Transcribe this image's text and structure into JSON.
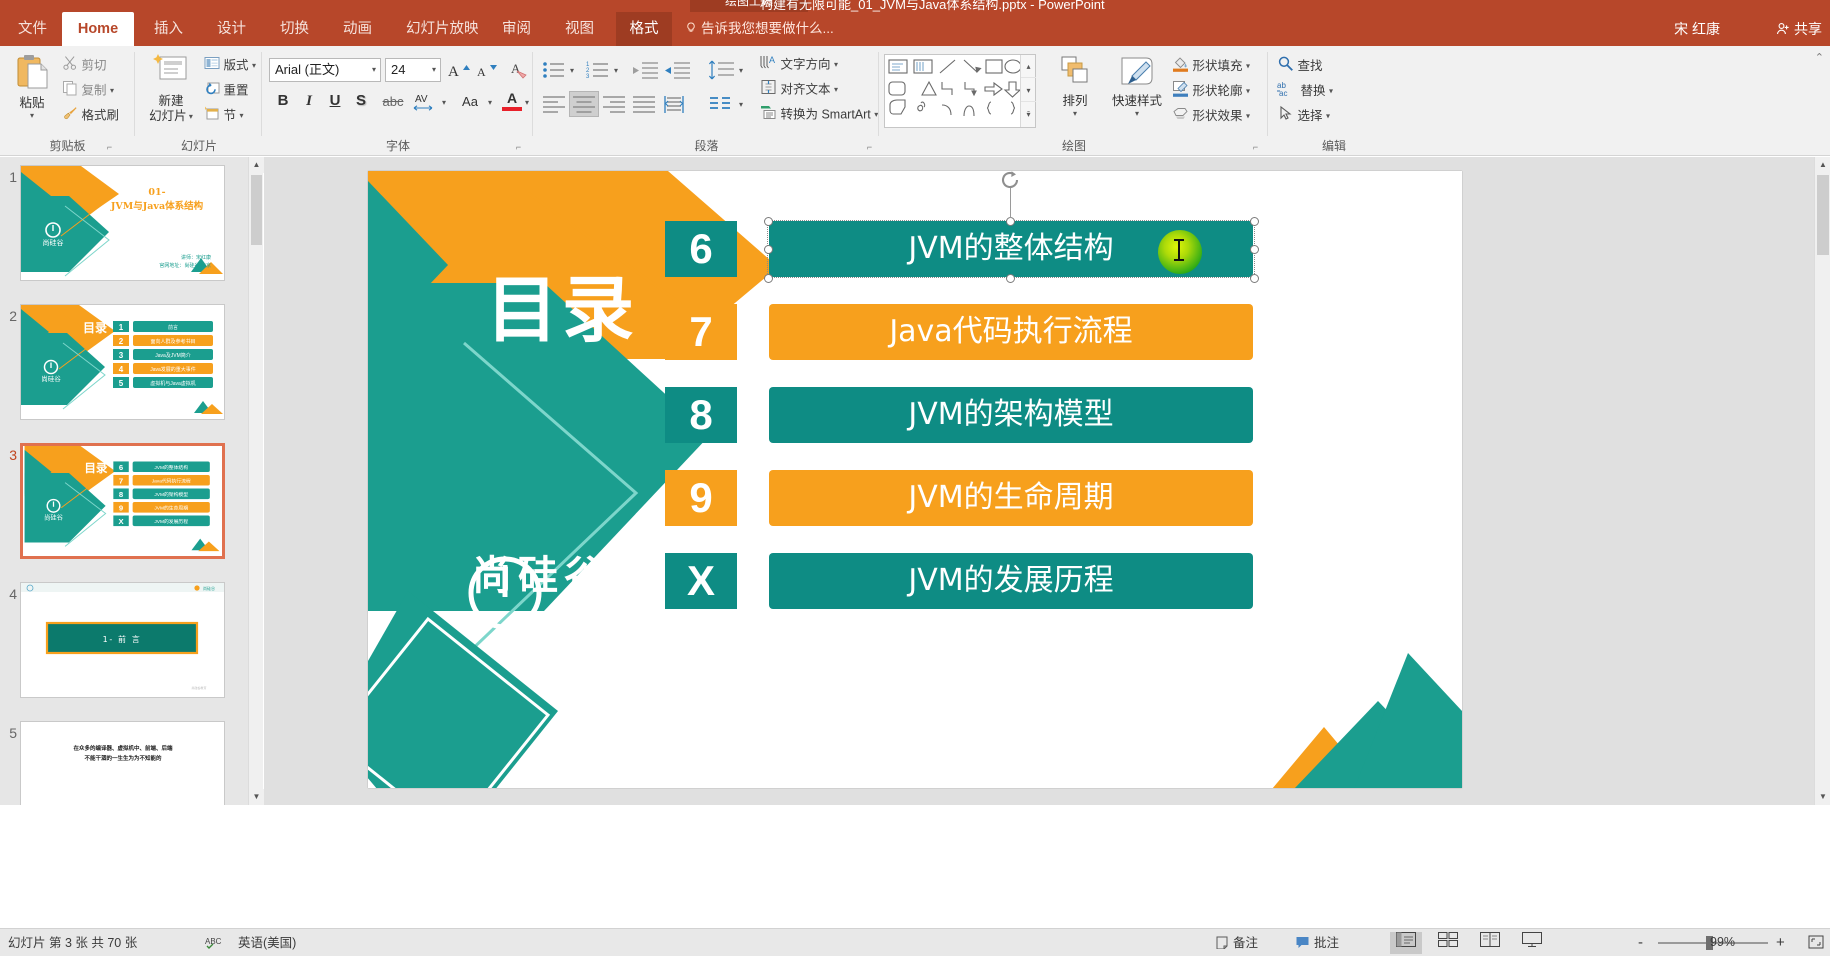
{
  "window": {
    "title": "构建有无限可能_01_JVM与Java体系结构.pptx - PowerPoint",
    "context_tab_group": "绘图工具",
    "user_name": "宋 红康",
    "share_label": "共享"
  },
  "tabs": [
    {
      "label": "文件",
      "active": false,
      "kind": "file"
    },
    {
      "label": "Home",
      "active": true,
      "kind": "normal"
    },
    {
      "label": "插入",
      "active": false,
      "kind": "normal"
    },
    {
      "label": "设计",
      "active": false,
      "kind": "normal"
    },
    {
      "label": "切换",
      "active": false,
      "kind": "normal"
    },
    {
      "label": "动画",
      "active": false,
      "kind": "normal"
    },
    {
      "label": "幻灯片放映",
      "active": false,
      "kind": "normal"
    },
    {
      "label": "审阅",
      "active": false,
      "kind": "normal"
    },
    {
      "label": "视图",
      "active": false,
      "kind": "normal"
    },
    {
      "label": "格式",
      "active": false,
      "kind": "context"
    }
  ],
  "tell_me": "告诉我您想要做什么...",
  "ribbon": {
    "groups": [
      {
        "name": "clipboard",
        "label": "剪贴板",
        "has_launcher": true
      },
      {
        "name": "slides",
        "label": "幻灯片",
        "has_launcher": false
      },
      {
        "name": "font",
        "label": "字体",
        "has_launcher": true
      },
      {
        "name": "paragraph",
        "label": "段落",
        "has_launcher": true
      },
      {
        "name": "drawing",
        "label": "绘图",
        "has_launcher": true
      },
      {
        "name": "editing",
        "label": "编辑",
        "has_launcher": false
      }
    ],
    "clipboard": {
      "paste": "粘贴",
      "cut": "剪切",
      "copy": "复制",
      "format_painter": "格式刷"
    },
    "slides": {
      "new_slide": "新建\n幻灯片",
      "new_slide_l1": "新建",
      "new_slide_l2": "幻灯片",
      "layout": "版式",
      "reset": "重置",
      "section": "节"
    },
    "font": {
      "font_name": "Arial (正文)",
      "font_size": "24",
      "grow": "A",
      "shrink": "A",
      "clear_format": "清除所有格式",
      "bold": "B",
      "italic": "I",
      "underline": "U",
      "shadow": "S",
      "strikethrough": "abc",
      "char_spacing": "AV",
      "change_case": "Aa",
      "font_color": "A"
    },
    "paragraph": {
      "bullets": "项目符号",
      "numbering": "编号",
      "dec_indent": "减少缩进量",
      "inc_indent": "增加缩进量",
      "line_spacing": "行距",
      "columns": "分栏",
      "align_left": "左对齐",
      "align_center": "居中",
      "align_right": "右对齐",
      "justify": "两端对齐",
      "distribute": "分散对齐",
      "text_direction": "文字方向",
      "align_text": "对齐文本",
      "convert_smartart": "转换为 SmartArt"
    },
    "drawing": {
      "arrange": "排列",
      "quick_styles": "快速样式",
      "shape_fill": "形状填充",
      "shape_outline": "形状轮廓",
      "shape_effects": "形状效果"
    },
    "editing": {
      "find": "查找",
      "replace": "替换",
      "select": "选择"
    }
  },
  "thumbnails": [
    {
      "number": "1",
      "selected": false,
      "type": "title",
      "title_l1": "01-",
      "title_l2": "JVM与Java体系结构",
      "footer_l1": "讲师：宋红康",
      "footer_l2": "官网地址：尚硅谷-北京"
    },
    {
      "number": "2",
      "selected": false,
      "type": "toc",
      "heading": "目录",
      "items": [
        {
          "n": "1",
          "t": "前言",
          "c": "teal"
        },
        {
          "n": "2",
          "t": "面向人群及参考书目",
          "c": "orange"
        },
        {
          "n": "3",
          "t": "Java及JVM简介",
          "c": "teal"
        },
        {
          "n": "4",
          "t": "Java发展的重大事件",
          "c": "orange"
        },
        {
          "n": "5",
          "t": "虚拟机与Java虚拟机",
          "c": "teal"
        }
      ]
    },
    {
      "number": "3",
      "selected": true,
      "type": "toc",
      "heading": "目录",
      "items": [
        {
          "n": "6",
          "t": "JVM的整体结构",
          "c": "teal"
        },
        {
          "n": "7",
          "t": "Java代码执行流程",
          "c": "orange"
        },
        {
          "n": "8",
          "t": "JVM的架构模型",
          "c": "teal"
        },
        {
          "n": "9",
          "t": "JVM的生命周期",
          "c": "orange"
        },
        {
          "n": "X",
          "t": "JVM的发展历程",
          "c": "teal"
        }
      ]
    },
    {
      "number": "4",
      "selected": false,
      "type": "section",
      "banner": "1- 前 言"
    },
    {
      "number": "5",
      "selected": false,
      "type": "text",
      "line1": "在众多的编译器、虚拟机中、前端、后端",
      "line2": "不能干涸的一生生为为不知能的"
    }
  ],
  "slide": {
    "heading": "目录",
    "logo": "尚硅谷",
    "items": [
      {
        "number": "6",
        "text": "JVM的整体结构",
        "color": "teal",
        "selected": true
      },
      {
        "number": "7",
        "text": "Java代码执行流程",
        "color": "orange",
        "selected": false
      },
      {
        "number": "8",
        "text": "JVM的架构模型",
        "color": "teal",
        "selected": false
      },
      {
        "number": "9",
        "text": "JVM的生命周期",
        "color": "orange",
        "selected": false
      },
      {
        "number": "X",
        "text": "JVM的发展历程",
        "color": "teal",
        "selected": false
      }
    ]
  },
  "status": {
    "slide_counter": "幻灯片 第 3 张  共 70 张",
    "language": "英语(美国)",
    "notes": "备注",
    "comments": "批注",
    "zoom_level": "99%",
    "zoom_out": "-",
    "zoom_in": "+"
  },
  "colors": {
    "ribbon_red": "#b7472a",
    "context_red": "#9e3c22",
    "teal": "#1b9e8f",
    "teal_dark": "#119088",
    "orange": "#f7a01d",
    "slide_bg": "#e0e0e0",
    "selection_orange": "#e0714f",
    "accent_blue": "#2b6fae"
  }
}
